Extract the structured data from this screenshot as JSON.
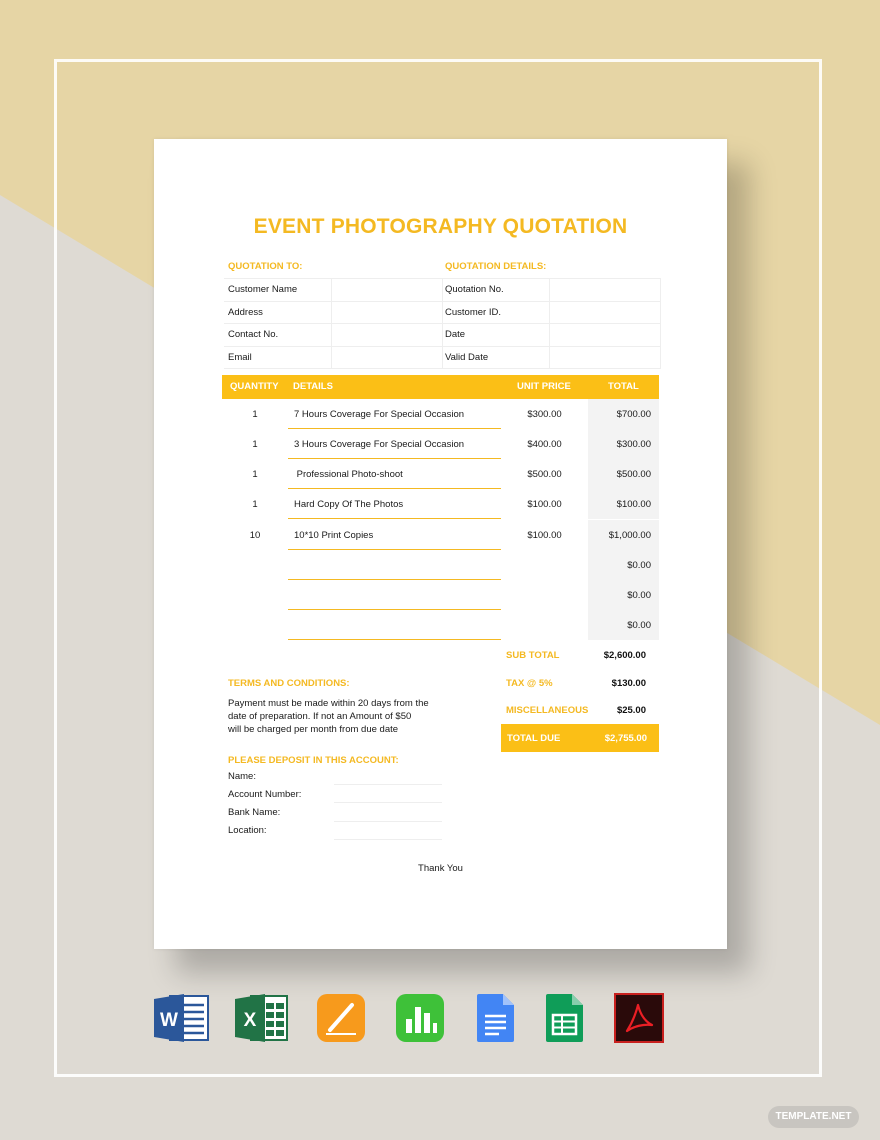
{
  "document": {
    "title": "EVENT PHOTOGRAPHY QUOTATION",
    "quotation_to": {
      "heading": "QUOTATION TO:",
      "fields": [
        "Customer Name",
        "Address",
        "Contact No.",
        "Email"
      ]
    },
    "quotation_details": {
      "heading": "QUOTATION DETAILS:",
      "fields": [
        "Quotation No.",
        "Customer ID.",
        "Date",
        "Valid Date"
      ]
    },
    "items_table": {
      "headers": {
        "quantity": "QUANTITY",
        "details": "DETAILS",
        "unit_price": "UNIT PRICE",
        "total": "TOTAL"
      },
      "rows": [
        {
          "quantity": "1",
          "details": "7 Hours Coverage For Special Occasion",
          "unit_price": "$300.00",
          "total": "$700.00"
        },
        {
          "quantity": "1",
          "details": "3 Hours Coverage For Special Occasion",
          "unit_price": "$400.00",
          "total": "$300.00"
        },
        {
          "quantity": "1",
          "details": " Professional Photo-shoot",
          "unit_price": "$500.00",
          "total": "$500.00"
        },
        {
          "quantity": "1",
          "details": "Hard Copy Of The Photos",
          "unit_price": "$100.00",
          "total": "$100.00"
        },
        {
          "quantity": "10",
          "details": "10*10 Print Copies",
          "unit_price": "$100.00",
          "total": "$1,000.00"
        },
        {
          "quantity": "",
          "details": "",
          "unit_price": "",
          "total": "$0.00"
        },
        {
          "quantity": "",
          "details": "",
          "unit_price": "",
          "total": "$0.00"
        },
        {
          "quantity": "",
          "details": "",
          "unit_price": "",
          "total": "$0.00"
        }
      ]
    },
    "summary": {
      "sub_total_label": "SUB TOTAL",
      "sub_total": "$2,600.00",
      "tax_label": "TAX @ 5%",
      "tax": "$130.00",
      "misc_label": "MISCELLANEOUS",
      "misc": "$25.00",
      "total_due_label": "TOTAL DUE",
      "total_due": "$2,755.00"
    },
    "terms": {
      "heading": "TERMS AND CONDITIONS:",
      "lines": [
        "Payment must be made within 20 days from the",
        "date of preparation. If not an Amount of $50",
        "will be charged per month from due date"
      ]
    },
    "deposit": {
      "heading": "PLEASE DEPOSIT IN THIS ACCOUNT:",
      "fields": [
        "Name:",
        "Account Number:",
        "Bank Name:",
        "Location:"
      ]
    },
    "footer": "Thank You"
  },
  "format_icons": [
    "word-icon",
    "excel-icon",
    "pages-icon",
    "numbers-icon",
    "google-docs-icon",
    "google-sheets-icon",
    "acrobat-pdf-icon"
  ],
  "brand_badge": "TEMPLATE.NET",
  "colors": {
    "accent": "#fbbf16",
    "title": "#f4b922",
    "bg_top": "#e6d5a5",
    "bg_bottom": "#dedad3"
  }
}
